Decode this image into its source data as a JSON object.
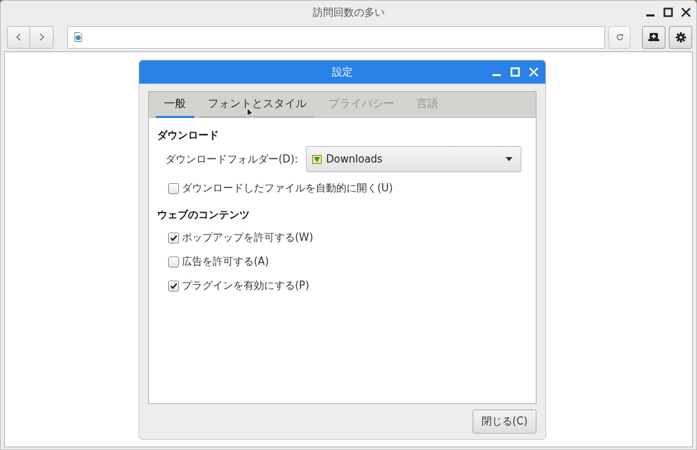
{
  "window": {
    "title": "訪問回数の多い"
  },
  "dialog": {
    "title": "設定",
    "tabs": [
      {
        "label": "一般",
        "selected": true,
        "hovered": false,
        "disabled": false
      },
      {
        "label": "フォントとスタイル",
        "selected": false,
        "hovered": true,
        "disabled": false
      },
      {
        "label": "プライバシー",
        "selected": false,
        "hovered": false,
        "disabled": true
      },
      {
        "label": "言語",
        "selected": false,
        "hovered": false,
        "disabled": true
      }
    ],
    "sections": [
      {
        "heading": "ダウンロード",
        "rows": [
          {
            "kind": "dropdown",
            "label": "ダウンロードフォルダー(D):",
            "value": "Downloads"
          },
          {
            "kind": "checkbox",
            "label": "ダウンロードしたファイルを自動的に開く(U)",
            "checked": false
          }
        ]
      },
      {
        "heading": "ウェブのコンテンツ",
        "rows": [
          {
            "kind": "checkbox",
            "label": "ポップアップを許可する(W)",
            "checked": true
          },
          {
            "kind": "checkbox",
            "label": "広告を許可する(A)",
            "checked": false
          },
          {
            "kind": "checkbox",
            "label": "プラグインを有効にする(P)",
            "checked": true
          }
        ]
      }
    ],
    "buttons": [
      "閉じる(C)"
    ]
  }
}
